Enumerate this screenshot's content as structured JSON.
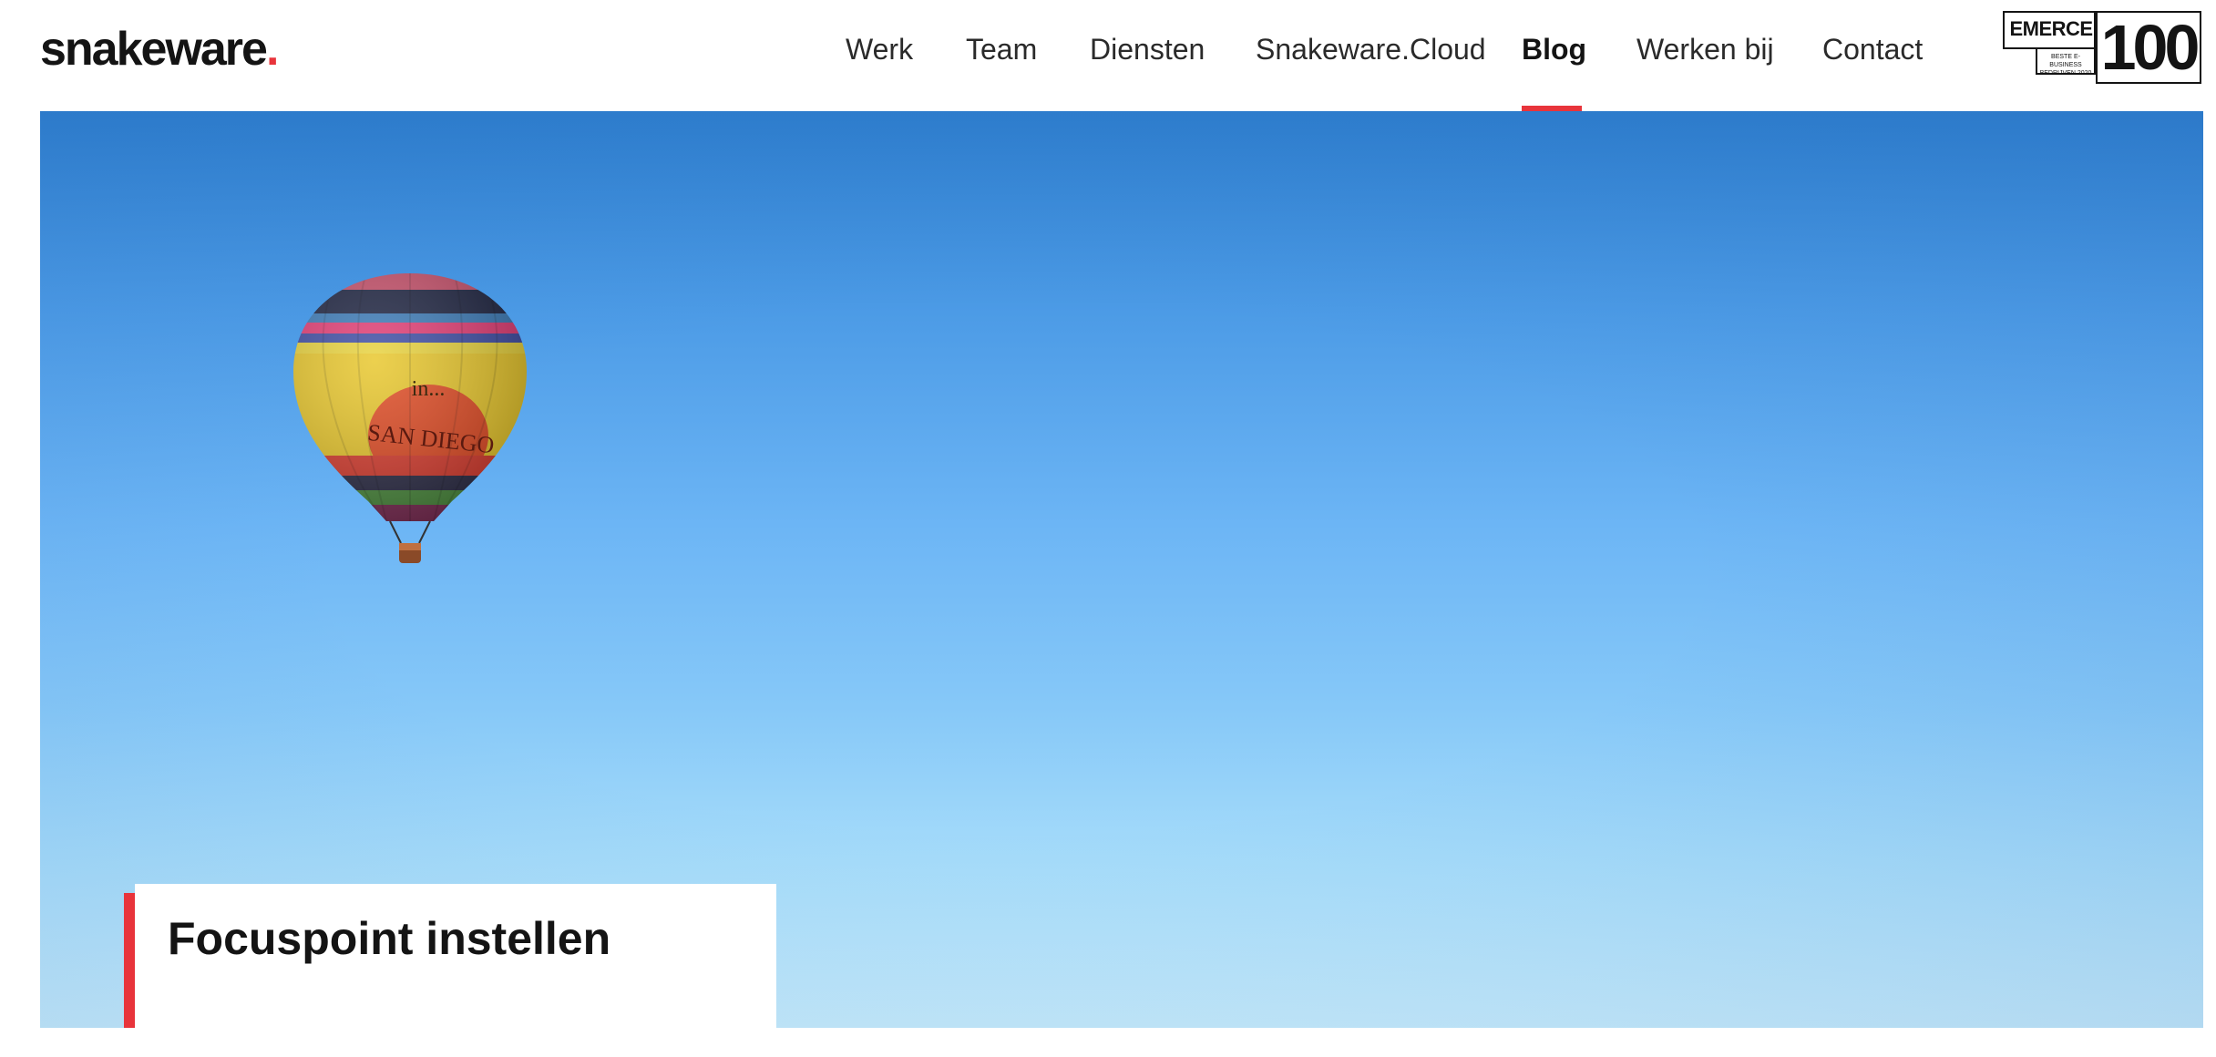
{
  "brand": {
    "logo_text": "snakeware",
    "logo_dot": ".",
    "accent_color": "#e8343b"
  },
  "nav": {
    "items": [
      {
        "label": "Werk",
        "active": false
      },
      {
        "label": "Team",
        "active": false
      },
      {
        "label": "Diensten",
        "active": false
      },
      {
        "label": "Snakeware.Cloud",
        "active": false
      },
      {
        "label": "Blog",
        "active": true
      },
      {
        "label": "Werken bij",
        "active": false
      },
      {
        "label": "Contact",
        "active": false
      }
    ]
  },
  "badge": {
    "title": "EMERCE",
    "subtitle_line1": "BESTE E-BUSINESS",
    "subtitle_line2": "BEDRIJVEN 2020",
    "number": "100"
  },
  "hero": {
    "image": "hot-air-balloon-in-blue-sky",
    "balloon_text_top": "in...",
    "balloon_text_main": "SAN DIEGO",
    "card_title": "Focuspoint instellen"
  }
}
